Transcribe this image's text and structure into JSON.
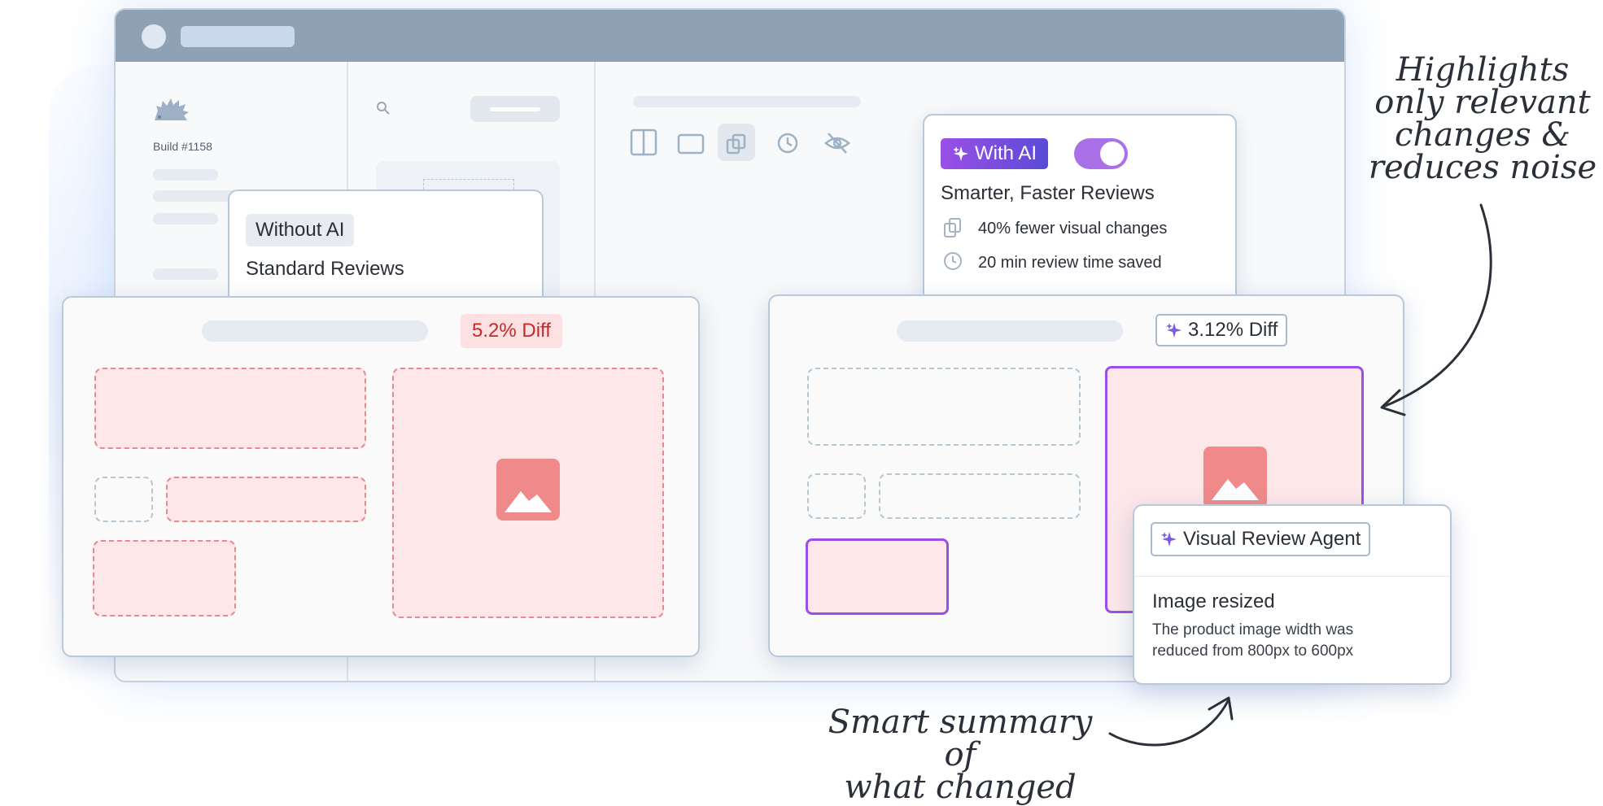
{
  "app": {
    "build_label": "Build #1158"
  },
  "without_ai": {
    "badge": "Without AI",
    "title": "Standard Reviews",
    "diff_badge": "5.2% Diff"
  },
  "with_ai": {
    "badge": "With AI",
    "toggle_on": true,
    "title": "Smarter, Faster Reviews",
    "stats": [
      {
        "icon": "stack-icon",
        "text": "40% fewer visual changes"
      },
      {
        "icon": "clock-icon",
        "text": "20 min review time saved"
      }
    ],
    "diff_badge": "3.12% Diff"
  },
  "agent_card": {
    "badge": "Visual Review Agent",
    "change_title": "Image resized",
    "change_line1": "The product image width was",
    "change_line2": "reduced from 800px to 600px"
  },
  "annotations": {
    "right_line1": "Highlights",
    "right_line2": "only relevant",
    "right_line3": "changes &",
    "right_line4": "reduces noise",
    "bottom_line1": "Smart summary of",
    "bottom_line2": "what changed"
  },
  "colors": {
    "accent_purple": "#9b4fe6",
    "ai_badge_gradient": [
      "#9b4fe6",
      "#5a4bd6"
    ],
    "diff_red_bg": "#fde7e9",
    "diff_red_text": "#c42a2a",
    "titlebar": "#8fa1b5"
  }
}
